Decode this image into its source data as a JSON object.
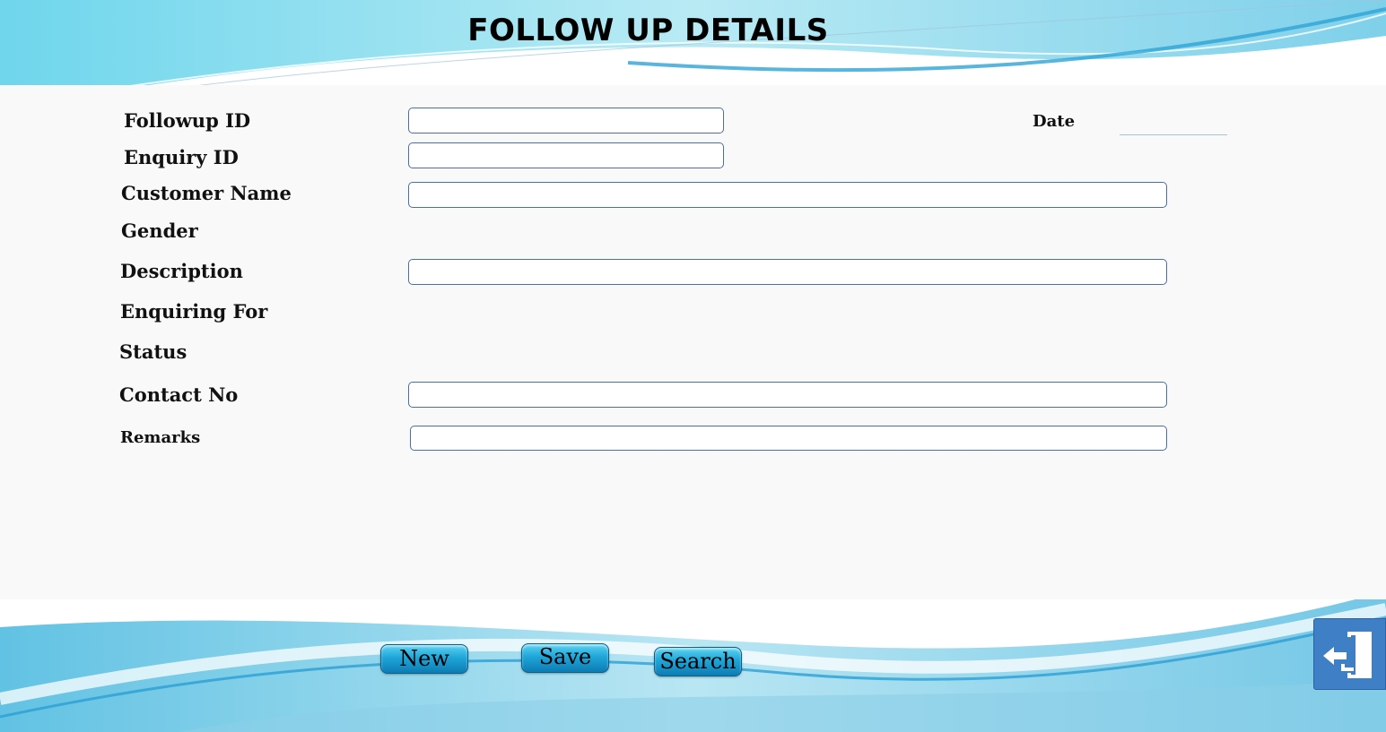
{
  "page": {
    "title": "FOLLOW UP DETAILS"
  },
  "form": {
    "followup_id": {
      "label": "Followup  ID",
      "value": ""
    },
    "enquiry_id": {
      "label": "Enquiry  ID",
      "value": ""
    },
    "date": {
      "label": "Date",
      "value": ""
    },
    "customer_name": {
      "label": "Customer Name",
      "value": ""
    },
    "gender": {
      "label": "Gender"
    },
    "description": {
      "label": "Description",
      "value": ""
    },
    "enquiring_for": {
      "label": "Enquiring For"
    },
    "status": {
      "label": "Status"
    },
    "contact_no": {
      "label": "Contact No",
      "value": ""
    },
    "remarks": {
      "label": "Remarks",
      "value": ""
    }
  },
  "buttons": {
    "new": "New",
    "save": "Save",
    "search": "Search"
  },
  "icons": {
    "exit": "exit-door-icon"
  },
  "colors": {
    "wave_light": "#8fdcef",
    "wave_dark": "#29a6d9",
    "field_border": "#4a6fa0",
    "exit_bg": "#3f7fc6"
  }
}
